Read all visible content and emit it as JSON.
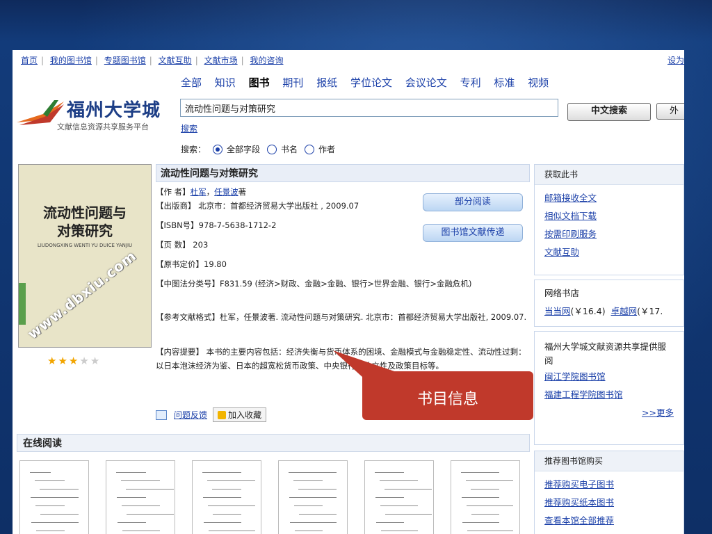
{
  "callout": "书目信息",
  "topnav": [
    "首页",
    "我的图书馆",
    "专题图书馆",
    "文献互助",
    "文献市场",
    "我的咨询"
  ],
  "topnav_right": "设为",
  "logo": {
    "title": "福州大学城",
    "subtitle": "文献信息资源共享服务平台"
  },
  "categories": [
    "全部",
    "知识",
    "图书",
    "期刊",
    "报纸",
    "学位论文",
    "会议论文",
    "专利",
    "标准",
    "视频"
  ],
  "active_category": "图书",
  "search": {
    "value": "流动性问题与对策研究",
    "button": "中文搜索",
    "button2": "外",
    "link": "搜索",
    "scope_label": "搜索：",
    "scopes": [
      "全部字段",
      "书名",
      "作者"
    ]
  },
  "cover": {
    "title_line1": "流动性问题与",
    "title_line2": "对策研究",
    "pinyin": "LIUDONGXING WENTI YU DUICE YANJIU",
    "watermark": "www.dbxiu.com"
  },
  "rating": {
    "stars": 3,
    "max": 5
  },
  "book": {
    "title": "流动性问题与对策研究",
    "author_label": "【作 者】",
    "authors": [
      "杜军",
      "任景波"
    ],
    "author_suffix": "著",
    "publisher": "【出版商】 北京市：首都经济贸易大学出版社 , 2009.07",
    "isbn": "【ISBN号】978-7-5638-1712-2",
    "pages": "【页 数】 203",
    "price": "【原书定价】19.80",
    "clc": "【中图法分类号】F831.59 (经济>财政、金融>金融、银行>世界金融、银行>金融危机)",
    "citation": "【参考文献格式】杜军，任景波著. 流动性问题与对策研究. 北京市：首都经济贸易大学出版社, 2009.07.",
    "summary": "【内容提要】 本书的主要内容包括：经济失衡与货币体系的困境、金融模式与金融稳定性、流动性过剩：以日本泡沫经济为鉴、日本的超宽松货币政策、中央银行的独立性及政策目标等。",
    "btn_partial": "部分阅读",
    "btn_delivery": "图书馆文献传递",
    "feedback": "问题反馈",
    "favorite": "加入收藏"
  },
  "online_read": {
    "title": "在线阅读",
    "pages": 6
  },
  "sidebar": {
    "get": {
      "title": "获取此书",
      "links": [
        "邮箱接收全文",
        "相似文档下载",
        "按需印刷服务",
        "文献互助"
      ]
    },
    "store": {
      "title": "网络书店",
      "items": [
        {
          "name": "当当网",
          "price": "(￥16.4)"
        },
        {
          "name": "卓越网",
          "price": "(￥17."
        }
      ]
    },
    "libs": {
      "text": "福州大学城文献资源共享提供服阅",
      "links": [
        "闽江学院图书馆",
        "福建工程学院图书馆"
      ],
      "more": ">>更多"
    },
    "buy": {
      "title": "推荐图书馆购买",
      "links": [
        "推荐购买电子图书",
        "推荐购买纸本图书",
        "查看本馆全部推荐"
      ]
    }
  }
}
